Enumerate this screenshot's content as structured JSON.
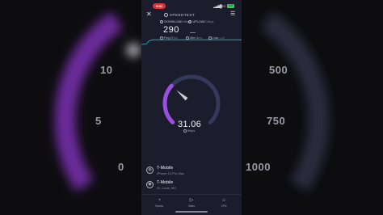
{
  "colors": {
    "accent_purple": "#9b4fe0",
    "gauge_track": "#34385a",
    "graph_line": "#2fb7c4",
    "phone_bg": "#1b1d2c",
    "status_pill": "#d8323a",
    "battery": "#3bd45a"
  },
  "status_bar": {
    "time": "9:52",
    "network": "5G",
    "battery": "100"
  },
  "header": {
    "close_icon": "close-icon",
    "brand": "SPEEDTEST",
    "menu_icon": "hamburger-menu-icon"
  },
  "metrics": {
    "download_label": "DOWNLOAD",
    "download_unit": "Mbps",
    "download_value": "290",
    "upload_label": "UPLOAD",
    "upload_unit": "Mbps",
    "upload_value": ""
  },
  "stats": {
    "ping_label": "Ping",
    "ping_unit": "ms",
    "ping_value": "17",
    "jitter_label": "Jitter",
    "jitter_unit": "ms",
    "jitter_value": "4",
    "loss_label": "Loss",
    "loss_unit": "%",
    "loss_value": "—"
  },
  "gauge": {
    "current_value": "31.06",
    "unit": "Mbps",
    "fraction": 0.32
  },
  "background_scale": {
    "labels": [
      "10",
      "5",
      "0",
      "500",
      "750",
      "1000"
    ]
  },
  "servers": [
    {
      "icon": "globe-icon",
      "name": "T-Mobile",
      "sub": "iPhone 13 Pro Max",
      "action": ""
    },
    {
      "icon": "location-pin-icon",
      "name": "T-Mobile",
      "sub": "St. Louis, MO",
      "action": ""
    }
  ],
  "bottom_nav": [
    {
      "icon": "speedometer-icon",
      "label": "Speed"
    },
    {
      "icon": "video-play-icon",
      "label": "Video"
    },
    {
      "icon": "lock-icon",
      "label": "VPN"
    }
  ]
}
